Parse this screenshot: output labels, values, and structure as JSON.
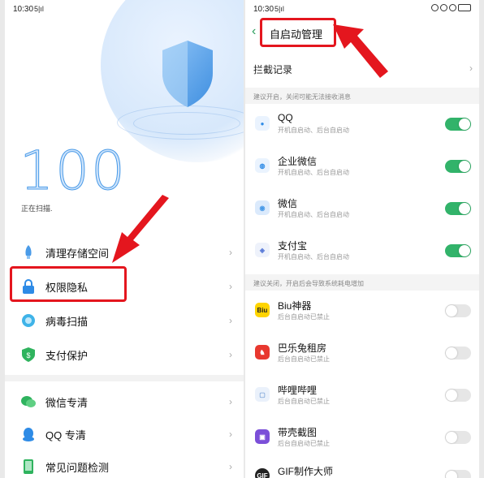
{
  "left": {
    "status": {
      "time": "10:30",
      "signal": "5|ıl"
    },
    "score": "100",
    "scan_text": "正在扫描.",
    "menu": [
      {
        "label": "清理存储空间",
        "icon": "rocket-icon"
      },
      {
        "label": "权限隐私",
        "icon": "lock-icon"
      },
      {
        "label": "病毒扫描",
        "icon": "virus-scan-icon"
      },
      {
        "label": "支付保护",
        "icon": "shield-dollar-icon"
      },
      {
        "label": "微信专清",
        "icon": "wechat-icon"
      },
      {
        "label": "QQ 专清",
        "icon": "qq-icon"
      },
      {
        "label": "常见问题检测",
        "icon": "phone-check-icon"
      }
    ],
    "chevron": "›"
  },
  "right": {
    "status": {
      "time": "10:30",
      "signal": "5|ıl"
    },
    "title": "自启动管理",
    "back": "‹",
    "intercept_label": "拦截记录",
    "chevron": "›",
    "section1": "建议开启，关闭可能无法接收消息",
    "section2": "建议关闭，开启后会导致系统耗电增加",
    "apps_on": [
      {
        "name": "QQ",
        "sub": "开机自启动、后台自启动"
      },
      {
        "name": "企业微信",
        "sub": "开机自启动、后台自启动"
      },
      {
        "name": "微信",
        "sub": "开机自启动、后台自启动"
      },
      {
        "name": "支付宝",
        "sub": "开机自启动、后台自启动"
      }
    ],
    "apps_off": [
      {
        "name": "Biu神器",
        "sub": "后台自启动已禁止",
        "badge": "Biu"
      },
      {
        "name": "巴乐兔租房",
        "sub": "后台自启动已禁止",
        "badge": ""
      },
      {
        "name": "哔哩哔哩",
        "sub": "后台自启动已禁止",
        "badge": ""
      },
      {
        "name": "带壳截图",
        "sub": "后台自启动已禁止",
        "badge": ""
      },
      {
        "name": "GIF制作大师",
        "sub": "",
        "badge": "GIF"
      }
    ]
  },
  "colors": {
    "accent_green": "#32b36a",
    "highlight_red": "#e4161e",
    "score_blue": "#4a9be8"
  }
}
